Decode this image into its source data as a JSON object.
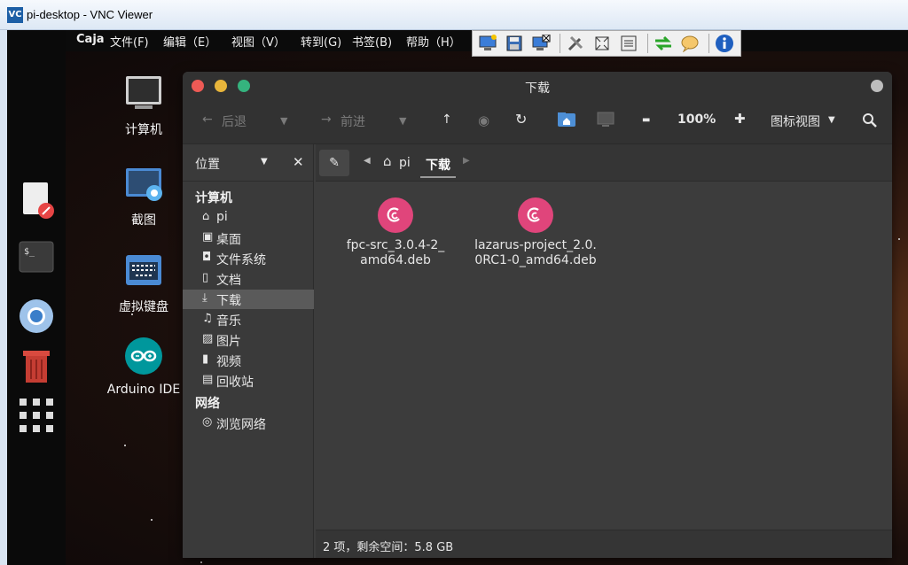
{
  "vnc": {
    "logo": "VC",
    "title": "pi-desktop - VNC Viewer"
  },
  "menubar": {
    "app": "Caja",
    "items": [
      "文件(F)",
      "编辑（E）",
      "视图（V）",
      "转到(G)",
      "书签(B)",
      "帮助（H）"
    ]
  },
  "desktop": {
    "icons": [
      {
        "label": "计算机",
        "icon": "computer-icon"
      },
      {
        "label": "截图",
        "icon": "screenshot-icon"
      },
      {
        "label": "虚拟键盘",
        "icon": "keyboard-icon"
      },
      {
        "label": "Arduino IDE",
        "icon": "arduino-icon"
      }
    ]
  },
  "caja": {
    "title": "下载",
    "toolbar": {
      "back": "后退",
      "forward": "前进",
      "zoom": "100%",
      "view_mode": "图标视图"
    },
    "sidebar": {
      "header": "位置",
      "computer_section": "计算机",
      "network_section": "网络",
      "items": [
        {
          "label": "pi",
          "icon": "home-icon"
        },
        {
          "label": "桌面",
          "icon": "desktop-icon"
        },
        {
          "label": "文件系统",
          "icon": "drive-icon"
        },
        {
          "label": "文档",
          "icon": "document-icon"
        },
        {
          "label": "下载",
          "icon": "download-icon"
        },
        {
          "label": "音乐",
          "icon": "music-icon"
        },
        {
          "label": "图片",
          "icon": "picture-icon"
        },
        {
          "label": "视频",
          "icon": "video-icon"
        },
        {
          "label": "回收站",
          "icon": "trash-icon"
        }
      ],
      "network_items": [
        {
          "label": "浏览网络",
          "icon": "globe-icon"
        }
      ]
    },
    "path": [
      "pi",
      "下载"
    ],
    "files": [
      {
        "line1": "fpc-src_3.0.4-2_",
        "line2": "amd64.deb"
      },
      {
        "line1": "lazarus-project_2.0.",
        "line2": "0RC1-0_amd64.deb"
      }
    ],
    "status": "2 项，剩余空间：5.8 GB"
  }
}
